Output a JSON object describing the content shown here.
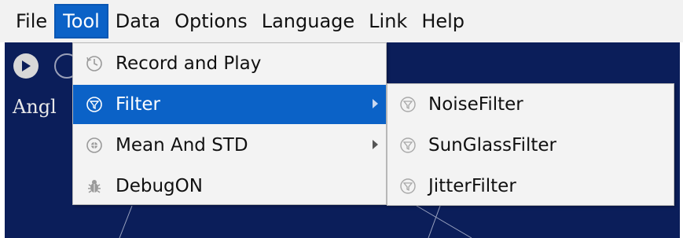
{
  "menubar": {
    "items": [
      {
        "label": "File"
      },
      {
        "label": "Tool",
        "active": true
      },
      {
        "label": "Data"
      },
      {
        "label": "Options"
      },
      {
        "label": "Language"
      },
      {
        "label": "Link"
      },
      {
        "label": "Help"
      }
    ]
  },
  "canvas": {
    "label": "Angl"
  },
  "tool_menu": {
    "items": [
      {
        "label": "Record and Play",
        "icon": "clock-icon"
      },
      {
        "label": "Filter",
        "icon": "filter-icon",
        "has_submenu": true,
        "selected": true
      },
      {
        "label": "Mean And STD",
        "icon": "mean-icon",
        "has_submenu": true
      },
      {
        "label": "DebugON",
        "icon": "bug-icon"
      }
    ]
  },
  "filter_submenu": {
    "items": [
      {
        "label": "NoiseFilter",
        "icon": "filter-icon"
      },
      {
        "label": "SunGlassFilter",
        "icon": "filter-icon"
      },
      {
        "label": "JitterFilter",
        "icon": "filter-icon"
      }
    ]
  },
  "colors": {
    "accent": "#0b62c7",
    "canvas_bg": "#0b1e5a",
    "menu_bg": "#f3f3f3"
  }
}
